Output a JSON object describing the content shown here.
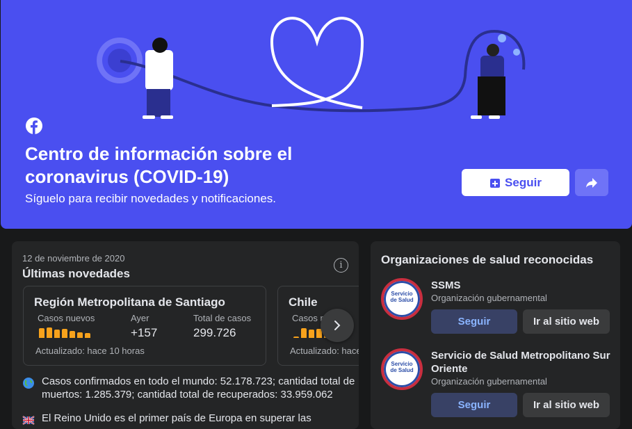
{
  "hero": {
    "title": "Centro de información sobre el coronavirus (COVID-19)",
    "subtitle": "Síguelo para recibir novedades y notificaciones.",
    "follow_label": "Seguir",
    "icons": [
      "facebook-logo-icon",
      "follow-plus-icon",
      "share-arrow-icon"
    ],
    "colors": {
      "hero_bg": "#4a4ff0",
      "accent": "#4a4ff0"
    }
  },
  "updates": {
    "date": "12 de noviembre de 2020",
    "title": "Últimas novedades",
    "regions": [
      {
        "name": "Región Metropolitana de Santiago",
        "new_cases_label": "Casos nuevos",
        "new_cases_trend": [
          0.9,
          1.0,
          0.8,
          0.85,
          0.65,
          0.55,
          0.45
        ],
        "yesterday_label": "Ayer",
        "yesterday_value": "+157",
        "total_label": "Total de casos",
        "total_value": "299.726",
        "updated": "Actualizado: hace 10 horas"
      },
      {
        "name": "Chile",
        "new_cases_label": "Casos n",
        "new_cases_trend": [
          0.1,
          0.9,
          0.8,
          0.85,
          0.7
        ],
        "updated": "Actualizado: hace"
      }
    ],
    "news": [
      {
        "icon": "globe-icon",
        "text": "Casos confirmados en todo el mundo: 52.178.723; cantidad total de muertos: 1.285.379; cantidad total de recuperados: 33.959.062"
      },
      {
        "icon": "flag-icon",
        "text": "El Reino Unido es el primer país de Europa en superar las"
      }
    ]
  },
  "orgs": {
    "title": "Organizaciones de salud reconocidas",
    "items": [
      {
        "logo_text_1": "Servicio",
        "logo_text_2": "de Salud",
        "name": "SSMS",
        "type": "Organización gubernamental",
        "follow_label": "Seguir",
        "site_label": "Ir al sitio web"
      },
      {
        "logo_text_1": "Servicio",
        "logo_text_2": "de Salud",
        "name": "Servicio de Salud Metropolitano Sur Oriente",
        "type": "Organización gubernamental",
        "follow_label": "Seguir",
        "site_label": "Ir al sitio web"
      }
    ]
  }
}
